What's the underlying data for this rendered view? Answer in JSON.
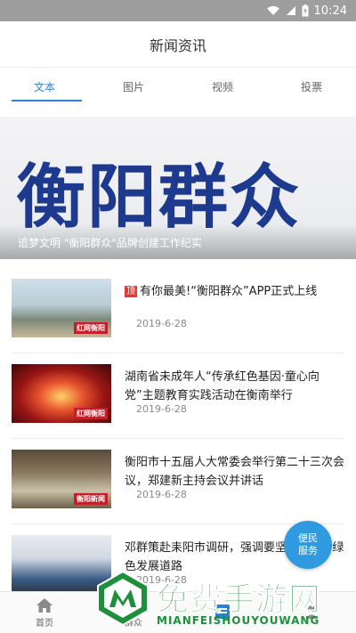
{
  "status_bar": {
    "time": "10:24",
    "icons": [
      "wifi-icon",
      "signal-icon",
      "battery-charging-icon"
    ]
  },
  "header": {
    "title": "新闻资讯"
  },
  "tabs": [
    {
      "label": "文本",
      "active": true
    },
    {
      "label": "图片",
      "active": false
    },
    {
      "label": "视频",
      "active": false
    },
    {
      "label": "投票",
      "active": false
    }
  ],
  "banner": {
    "headline": "衡阳群众",
    "caption": "追梦文明 \"衡阳群众\"品牌创建工作纪实"
  },
  "news": [
    {
      "tag": "顶",
      "title": "有你最美!“衡阳群众”APP正式上线",
      "date": "2019-6-28"
    },
    {
      "title": "湖南省未成年人“传承红色基因·童心向党”主题教育实践活动在衡南举行",
      "date": "2019-6-28"
    },
    {
      "title": "衡阳市十五届人大常委会举行第二十三次会议，郑建新主持会议并讲话",
      "date": "2019-6-28"
    },
    {
      "title": "邓群策赴耒阳市调研，强调要坚持...走好绿色发展道路",
      "date": "2019-6-28"
    }
  ],
  "thumbnails": {
    "badge_1": "红网衡阳",
    "badge_2": "红网衡阳",
    "badge_3": "衡阳新闻"
  },
  "service_button": {
    "line1": "便民",
    "line2": "服务"
  },
  "bottom_nav": [
    {
      "label": "首页",
      "icon": "home-icon"
    },
    {
      "label": "群众",
      "icon": "people-icon"
    },
    {
      "label": "",
      "icon": "news-icon"
    },
    {
      "label": "",
      "icon": "user-icon"
    }
  ],
  "watermark": {
    "text": "免费手游网",
    "sub": "MIANFEISHOUYOUWANG"
  },
  "colors": {
    "accent": "#2a82d6",
    "service": "#2f9ae0",
    "top_tag": "#e53935",
    "watermark": "#1e8f3a"
  }
}
